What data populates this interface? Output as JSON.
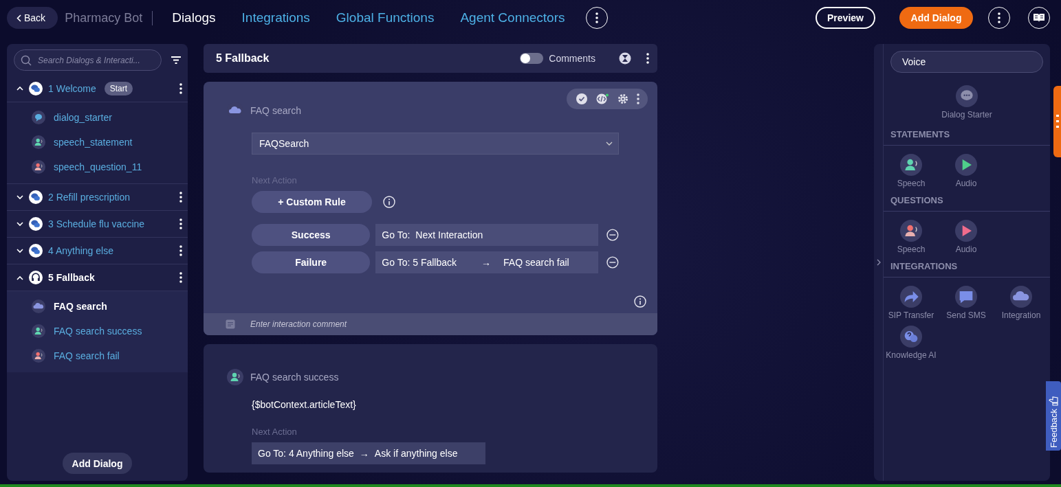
{
  "nav": {
    "back": "Back",
    "bot_name": "Pharmacy Bot",
    "tabs": [
      {
        "label": "Dialogs",
        "selected": true
      },
      {
        "label": "Integrations",
        "selected": false
      },
      {
        "label": "Global Functions",
        "selected": false
      },
      {
        "label": "Agent Connectors",
        "selected": false
      }
    ]
  },
  "actions": {
    "preview": "Preview",
    "add_dialog": "Add Dialog"
  },
  "sidebar": {
    "search_placeholder": "Search Dialogs & Interacti...",
    "dialogs": [
      {
        "label": "1 Welcome",
        "badge": "Start",
        "kind": "chat",
        "expanded": true,
        "selected": false,
        "children": [
          {
            "label": "dialog_starter",
            "kind": "starter",
            "selected": false
          },
          {
            "label": "speech_statement",
            "kind": "statement",
            "selected": false
          },
          {
            "label": "speech_question_11",
            "kind": "question",
            "selected": false
          }
        ]
      },
      {
        "label": "2 Refill prescription",
        "kind": "chat",
        "expanded": false,
        "selected": false
      },
      {
        "label": "3 Schedule flu vaccine",
        "kind": "chat",
        "expanded": false,
        "selected": false
      },
      {
        "label": "4 Anything else",
        "kind": "chat",
        "expanded": false,
        "selected": false
      },
      {
        "label": "5 Fallback",
        "kind": "headset",
        "expanded": true,
        "selected": true,
        "children": [
          {
            "label": "FAQ search",
            "kind": "integration",
            "selected": true
          },
          {
            "label": "FAQ search success",
            "kind": "statement",
            "selected": false
          },
          {
            "label": "FAQ search fail",
            "kind": "question",
            "selected": false
          }
        ]
      }
    ],
    "add_button": "Add Dialog"
  },
  "editor": {
    "title": "5 Fallback",
    "comments": {
      "label": "Comments",
      "on": false
    },
    "cards": [
      {
        "kind": "integration",
        "selected": true,
        "title": "FAQ search",
        "select_value": "FAQSearch",
        "next_action_label": "Next Action",
        "custom_rule": "+ Custom Rule",
        "rules": [
          {
            "label": "Success",
            "goto": "Go To:",
            "target": "Next Interaction"
          },
          {
            "label": "Failure",
            "goto": "Go To: 5 Fallback",
            "arrow": "→",
            "target": "FAQ search fail"
          }
        ],
        "comment_placeholder": "Enter interaction comment"
      },
      {
        "kind": "statement",
        "selected": false,
        "title": "FAQ search success",
        "message": "{$botContext.articleText}",
        "next_action_label": "Next Action",
        "goto": "Go To: 4 Anything else",
        "arrow": "→",
        "target": "Ask if anything else"
      }
    ]
  },
  "palette": {
    "channel": "Voice",
    "starter": "Dialog Starter",
    "sections": [
      {
        "title": "STATEMENTS",
        "items": [
          {
            "label": "Speech",
            "kind": "speech_statement"
          },
          {
            "label": "Audio",
            "kind": "audio_statement"
          }
        ]
      },
      {
        "title": "QUESTIONS",
        "items": [
          {
            "label": "Speech",
            "kind": "speech_question"
          },
          {
            "label": "Audio",
            "kind": "audio_question"
          }
        ]
      },
      {
        "title": "INTEGRATIONS",
        "items": [
          {
            "label": "SIP Transfer",
            "kind": "sip"
          },
          {
            "label": "Send SMS",
            "kind": "sms"
          },
          {
            "label": "Integration",
            "kind": "integration"
          },
          {
            "label": "Knowledge AI",
            "kind": "knowledge"
          }
        ]
      }
    ]
  },
  "feedback": "Feedback"
}
